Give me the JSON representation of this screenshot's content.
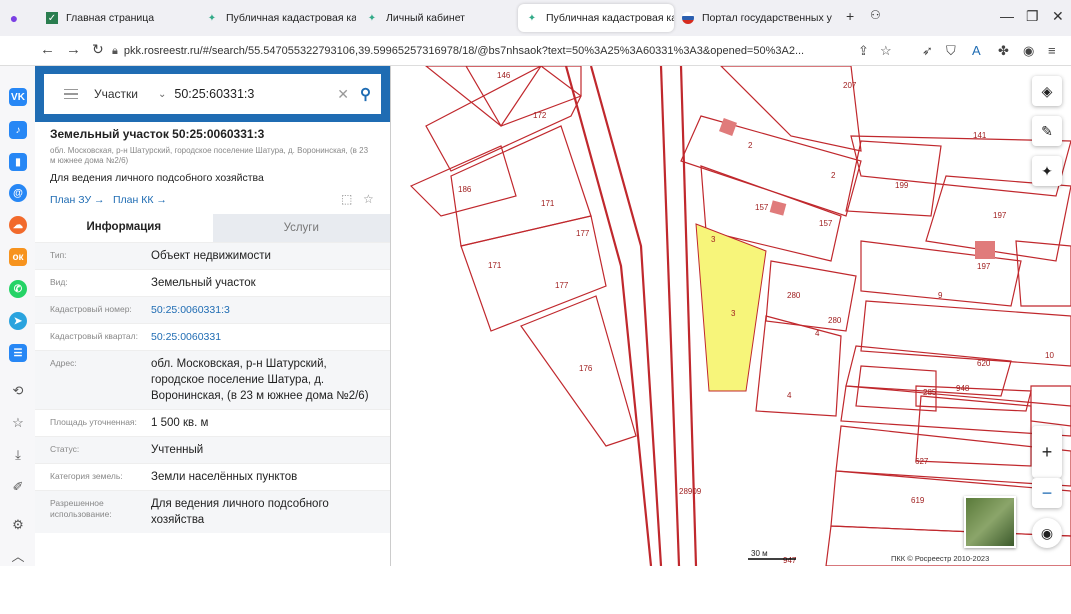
{
  "tabs": [
    {
      "label": "Главная страница",
      "active": false
    },
    {
      "label": "Публичная кадастровая кар",
      "active": false
    },
    {
      "label": "Личный кабинет",
      "active": false
    },
    {
      "label": "Публичная кадастровая кар",
      "active": true
    },
    {
      "label": "Портал государственных ус",
      "active": false
    }
  ],
  "url": "pkk.rosreestr.ru/#/search/55.547055322793106,39.59965257316978/18/@bs7nhsaok?text=50%3A25%3A60331%3A3&opened=50%3A2...",
  "search": {
    "mode": "Участки",
    "query": "50:25:60331:3"
  },
  "object": {
    "title": "Земельный участок 50:25:0060331:3",
    "address_short": "обл. Московская, р-н Шатурский, городское поселение Шатура, д. Воронинская, (в 23 м южнее дома №2/6)",
    "use": "Для ведения личного подсобного хозяйства",
    "plan_zu": "План ЗУ →",
    "plan_kk": "План КК →"
  },
  "panel_tabs": {
    "info": "Информация",
    "services": "Услуги"
  },
  "rows": [
    {
      "k": "Тип:",
      "v": "Объект недвижимости",
      "link": false
    },
    {
      "k": "Вид:",
      "v": "Земельный участок",
      "link": false
    },
    {
      "k": "Кадастровый номер:",
      "v": "50:25:0060331:3",
      "link": true
    },
    {
      "k": "Кадастровый квартал:",
      "v": "50:25:0060331",
      "link": true
    },
    {
      "k": "Адрес:",
      "v": "обл. Московская, р-н Шатурский, городское поселение Шатура, д. Воронинская, (в 23 м южнее дома №2/6)",
      "link": false
    },
    {
      "k": "Площадь уточненная:",
      "v": "1 500 кв. м",
      "link": false
    },
    {
      "k": "Статус:",
      "v": "Учтенный",
      "link": false
    },
    {
      "k": "Категория земель:",
      "v": "Земли населённых пунктов",
      "link": false
    },
    {
      "k": "Разрешенное использование:",
      "v": "Для ведения личного подсобного хозяйства",
      "link": false
    }
  ],
  "map": {
    "parcel_labels": [
      "146",
      "172",
      "207",
      "141",
      "2",
      "2",
      "199",
      "186",
      "171",
      "157",
      "157",
      "197",
      "177",
      "171",
      "197",
      "177",
      "280",
      "9",
      "280",
      "3",
      "3",
      "176",
      "4",
      "620",
      "10",
      "948",
      "285",
      "4",
      "224",
      "627",
      "619",
      "28909",
      "947"
    ],
    "scale": "30 м",
    "copyright": "ПКК © Росреестр 2010-2023",
    "selected_color": "#f7f57a",
    "line_color": "#c0282d"
  },
  "icons": {
    "sidebar": [
      "vk-icon",
      "music-icon",
      "stats-icon",
      "mail-icon",
      "cloud-icon",
      "ok-icon",
      "whatsapp-icon",
      "telegram-icon",
      "list-icon",
      "history-icon",
      "star-icon",
      "download-icon",
      "brush-icon",
      "settings-icon",
      "chevron-up-icon"
    ]
  }
}
